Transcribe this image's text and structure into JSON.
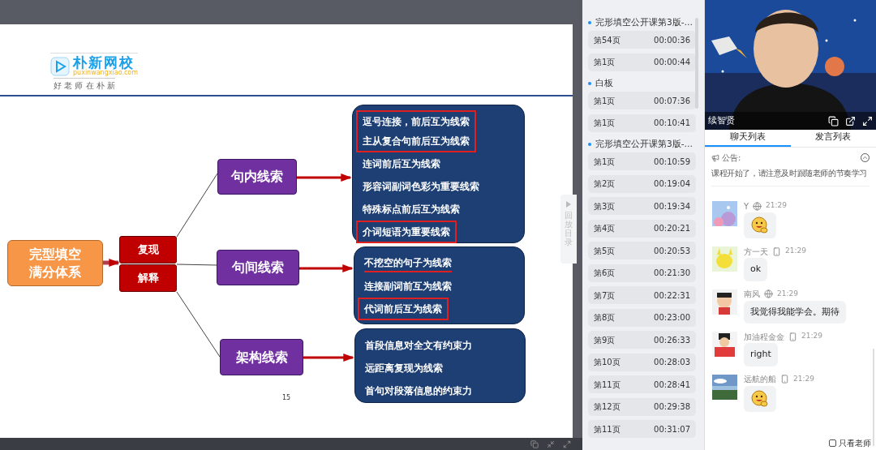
{
  "slide": {
    "logo": {
      "brand": "朴新网校",
      "domain": "puxinwangxiao.com",
      "slogan": "好 老 师 在 朴 新"
    },
    "root": [
      "完型填空",
      "满分体系"
    ],
    "methods": [
      "复现",
      "解释"
    ],
    "branches": [
      {
        "label": "句内线索",
        "clues": [
          {
            "text": "逗号连接，前后互为线索",
            "boxed": true,
            "underlined": false
          },
          {
            "text": "主从复合句前后互为线索",
            "boxed": true,
            "underlined": false
          },
          {
            "text": "连词前后互为线索",
            "boxed": false,
            "underlined": false
          },
          {
            "text": "形容词副词色彩为重要线索",
            "boxed": false,
            "underlined": false
          },
          {
            "text": "特殊标点前后互为线索",
            "boxed": false,
            "underlined": false
          },
          {
            "text": "介词短语为重要线索",
            "boxed": true,
            "underlined": false
          }
        ]
      },
      {
        "label": "句间线索",
        "clues": [
          {
            "text": "不挖空的句子为线索",
            "boxed": false,
            "underlined": true
          },
          {
            "text": "连接副词前互为线索",
            "boxed": false,
            "underlined": false
          },
          {
            "text": "代词前后互为线索",
            "boxed": true,
            "underlined": false
          }
        ]
      },
      {
        "label": "架构线索",
        "clues": [
          {
            "text": "首段信息对全文有约束力",
            "boxed": false,
            "underlined": false
          },
          {
            "text": "远距离复现为线索",
            "boxed": false,
            "underlined": false
          },
          {
            "text": "首句对段落信息的约束力",
            "boxed": false,
            "underlined": false
          }
        ]
      }
    ],
    "page_number": "15"
  },
  "replay_toggle": {
    "label": "回放目录"
  },
  "playlist": [
    {
      "title": "完形填空公开课第3版-…",
      "items": [
        {
          "page": "第54页",
          "time": "00:00:36"
        },
        {
          "page": "第1页",
          "time": "00:00:44"
        }
      ]
    },
    {
      "title": "白板",
      "items": [
        {
          "page": "第1页",
          "time": "00:07:36"
        },
        {
          "page": "第1页",
          "time": "00:10:41"
        }
      ]
    },
    {
      "title": "完形填空公开课第3版-…",
      "items": [
        {
          "page": "第1页",
          "time": "00:10:59"
        },
        {
          "page": "第2页",
          "time": "00:19:04"
        },
        {
          "page": "第3页",
          "time": "00:19:34"
        },
        {
          "page": "第4页",
          "time": "00:20:21"
        },
        {
          "page": "第5页",
          "time": "00:20:53"
        },
        {
          "page": "第6页",
          "time": "00:21:30"
        },
        {
          "page": "第7页",
          "time": "00:22:31"
        },
        {
          "page": "第8页",
          "time": "00:23:00"
        },
        {
          "page": "第9页",
          "time": "00:26:33"
        },
        {
          "page": "第10页",
          "time": "00:28:03"
        },
        {
          "page": "第11页",
          "time": "00:28:41"
        },
        {
          "page": "第12页",
          "time": "00:29:38"
        },
        {
          "page": "第11页",
          "time": "00:31:07"
        }
      ]
    }
  ],
  "video": {
    "name": "续智贤"
  },
  "tabs": [
    {
      "label": "聊天列表",
      "selected": true
    },
    {
      "label": "发言列表",
      "selected": false
    }
  ],
  "announcement": {
    "label": "公告:",
    "text": "课程开始了，请注意及时跟随老师的节奏学习"
  },
  "messages": [
    {
      "name": "Y",
      "mobile": false,
      "time": "21:29",
      "kind": "emoji"
    },
    {
      "name": "方一天",
      "mobile": true,
      "time": "21:29",
      "kind": "text",
      "text": "ok"
    },
    {
      "name": "南风",
      "mobile": false,
      "time": "21:29",
      "kind": "text",
      "text": "我觉得我能学会。期待"
    },
    {
      "name": "加油程金金",
      "mobile": true,
      "time": "21:29",
      "kind": "text",
      "text": "right"
    },
    {
      "name": "远航的船",
      "mobile": true,
      "time": "21:29",
      "kind": "emoji"
    }
  ],
  "filter": {
    "label": "只看老师",
    "checked": false
  }
}
